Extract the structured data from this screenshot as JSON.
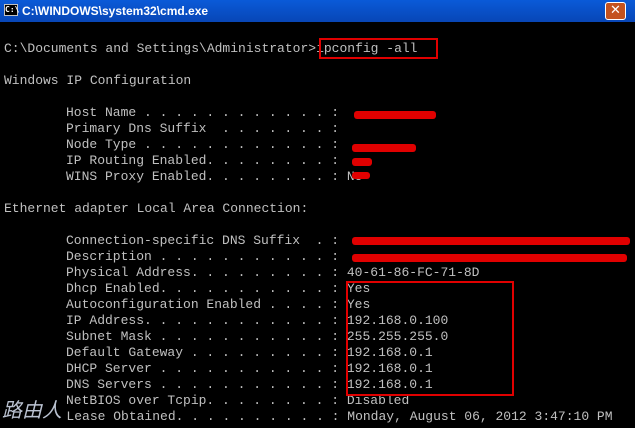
{
  "window": {
    "title": "C:\\WINDOWS\\system32\\cmd.exe",
    "icon": "cmd-icon",
    "close_glyph": "✕"
  },
  "console": {
    "prompt": "C:\\Documents and Settings\\Administrator>",
    "command": "ipconfig -all",
    "header": "Windows IP Configuration",
    "section": "Ethernet adapter Local Area Connection:",
    "global_entries": [
      {
        "label": "Host Name . . . . . . . . . . . . :",
        "value": ""
      },
      {
        "label": "Primary Dns Suffix  . . . . . . . :",
        "value": ""
      },
      {
        "label": "Node Type . . . . . . . . . . . . :",
        "value": ""
      },
      {
        "label": "IP Routing Enabled. . . . . . . . :",
        "value": ""
      },
      {
        "label": "WINS Proxy Enabled. . . . . . . . :",
        "value": "No"
      }
    ],
    "adapter_entries": [
      {
        "label": "Connection-specific DNS Suffix  . :",
        "value": ""
      },
      {
        "label": "Description . . . . . . . . . . . :",
        "value": ""
      },
      {
        "label": "Physical Address. . . . . . . . . :",
        "value": "40-61-86-FC-71-8D"
      },
      {
        "label": "Dhcp Enabled. . . . . . . . . . . :",
        "value": "Yes"
      },
      {
        "label": "Autoconfiguration Enabled . . . . :",
        "value": "Yes"
      },
      {
        "label": "IP Address. . . . . . . . . . . . :",
        "value": "192.168.0.100"
      },
      {
        "label": "Subnet Mask . . . . . . . . . . . :",
        "value": "255.255.255.0"
      },
      {
        "label": "Default Gateway . . . . . . . . . :",
        "value": "192.168.0.1"
      },
      {
        "label": "DHCP Server . . . . . . . . . . . :",
        "value": "192.168.0.1"
      },
      {
        "label": "DNS Servers . . . . . . . . . . . :",
        "value": "192.168.0.1"
      },
      {
        "label": "NetBIOS over Tcpip. . . . . . . . :",
        "value": "Disabled"
      },
      {
        "label": "Lease Obtained. . . . . . . . . . :",
        "value": "Monday, August 06, 2012 3:47:10 PM"
      }
    ]
  },
  "colors": {
    "console_text": "#c0c0c0",
    "console_bg": "#000000",
    "annotation": "#e00000",
    "titlebar": "#0a5ad8"
  },
  "watermark": {
    "text": "路由人"
  }
}
